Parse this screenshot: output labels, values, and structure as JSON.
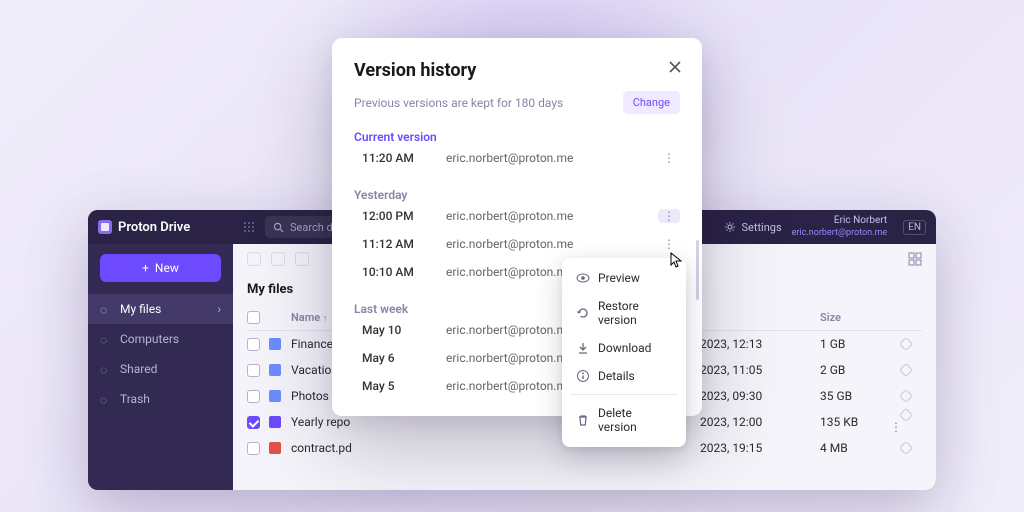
{
  "brand": "Proton Drive",
  "search": {
    "placeholder": "Search drive"
  },
  "settings_label": "Settings",
  "user": {
    "name": "Eric Norbert",
    "email": "eric.norbert@proton.me"
  },
  "lang": "EN",
  "sidebar": {
    "new_label": "New",
    "items": [
      {
        "label": "My files",
        "icon": "cloud-icon",
        "active": true,
        "chevron": true
      },
      {
        "label": "Computers",
        "icon": "monitor-icon"
      },
      {
        "label": "Shared",
        "icon": "link-icon"
      },
      {
        "label": "Trash",
        "icon": "trash-icon"
      }
    ]
  },
  "files": {
    "heading": "My files",
    "columns": {
      "name": "Name",
      "modified": "",
      "size": "Size"
    },
    "rows": [
      {
        "name": "Finances",
        "type": "folder",
        "modified": "2023, 12:13",
        "size": "1 GB"
      },
      {
        "name": "Vacation pl",
        "type": "folder",
        "modified": "2023, 11:05",
        "size": "2 GB"
      },
      {
        "name": "Photos",
        "type": "folder",
        "modified": "2023, 09:30",
        "size": "35 GB"
      },
      {
        "name": "Yearly repo",
        "type": "doc",
        "modified": "2023, 12:00",
        "size": "135 KB",
        "checked": true
      },
      {
        "name": "contract.pd",
        "type": "pdf",
        "modified": "2023, 19:15",
        "size": "4 MB"
      }
    ]
  },
  "modal": {
    "title": "Version history",
    "subtitle": "Previous versions are kept for 180 days",
    "change_label": "Change",
    "sections": [
      {
        "label": "Current version",
        "accent": true,
        "rows": [
          {
            "time": "11:20 AM",
            "email": "eric.norbert@proton.me"
          }
        ]
      },
      {
        "label": "Yesterday",
        "rows": [
          {
            "time": "12:00 PM",
            "email": "eric.norbert@proton.me",
            "hover": true
          },
          {
            "time": "11:12 AM",
            "email": "eric.norbert@proton.me"
          },
          {
            "time": "10:10 AM",
            "email": "eric.norbert@proton.me"
          }
        ]
      },
      {
        "label": "Last week",
        "rows": [
          {
            "time": "May 10",
            "email": "eric.norbert@proton.me"
          },
          {
            "time": "May 6",
            "email": "eric.norbert@proton.me"
          },
          {
            "time": "May 5",
            "email": "eric.norbert@proton.me"
          }
        ]
      }
    ]
  },
  "context_menu": {
    "items": [
      {
        "label": "Preview",
        "icon": "eye-icon"
      },
      {
        "label": "Restore version",
        "icon": "restore-icon"
      },
      {
        "label": "Download",
        "icon": "download-icon"
      },
      {
        "label": "Details",
        "icon": "info-icon"
      },
      {
        "divider": true
      },
      {
        "label": "Delete version",
        "icon": "trash-icon"
      }
    ]
  }
}
